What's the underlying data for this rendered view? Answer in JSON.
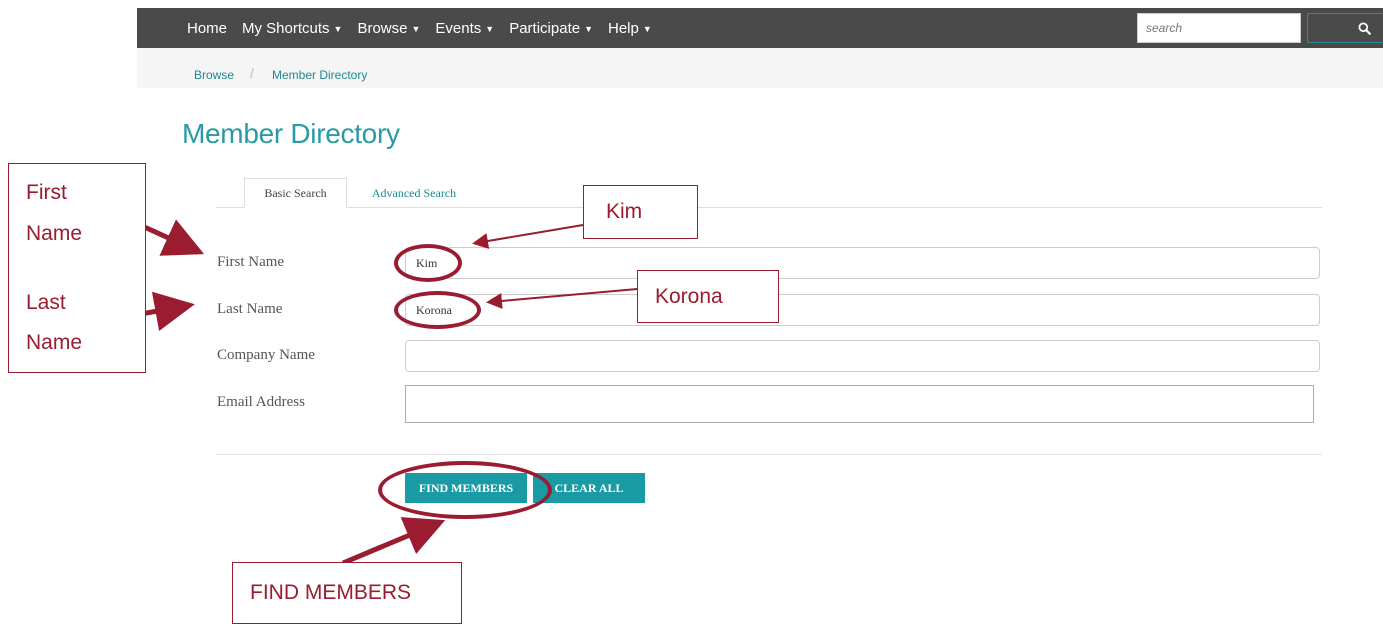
{
  "nav": {
    "items": [
      {
        "label": "Home",
        "has_caret": false
      },
      {
        "label": "My Shortcuts",
        "has_caret": true
      },
      {
        "label": "Browse",
        "has_caret": true
      },
      {
        "label": "Events",
        "has_caret": true
      },
      {
        "label": "Participate",
        "has_caret": true
      },
      {
        "label": "Help",
        "has_caret": true
      }
    ],
    "search_placeholder": "search",
    "search_icon": "magnifier-icon",
    "background_color": "#4a4a4a"
  },
  "breadcrumb": {
    "items": [
      "Browse",
      "Member Directory"
    ],
    "separator": "/"
  },
  "page": {
    "title": "Member Directory",
    "accent_color": "#2a9aa4"
  },
  "tabs": [
    {
      "label": "Basic Search",
      "active": true
    },
    {
      "label": "Advanced Search",
      "active": false
    }
  ],
  "form": {
    "fields": [
      {
        "label": "First Name",
        "value": "Kim"
      },
      {
        "label": "Last Name",
        "value": "Korona"
      },
      {
        "label": "Company Name",
        "value": ""
      },
      {
        "label": "Email Address",
        "value": ""
      }
    ],
    "find_button": "FIND MEMBERS",
    "clear_button": "CLEAR ALL"
  },
  "annotations": {
    "first_name_line1": "First",
    "first_name_line2": "Name",
    "last_name_line1": "Last",
    "last_name_line2": "Name",
    "kim": "Kim",
    "korona": "Korona",
    "find_members": "FIND MEMBERS",
    "color": "#9b1b30"
  }
}
